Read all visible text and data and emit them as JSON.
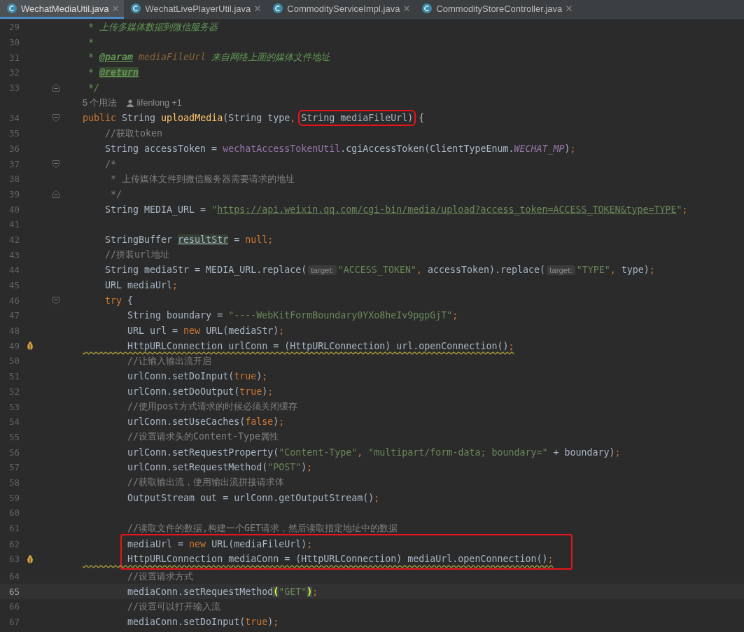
{
  "tabs": [
    {
      "label": "WechatMediaUtil.java",
      "selected": true
    },
    {
      "label": "WechatLivePlayerUtil.java",
      "selected": false
    },
    {
      "label": "CommodityServiceImpl.java",
      "selected": false
    },
    {
      "label": "CommodityStoreController.java",
      "selected": false
    }
  ],
  "editor": {
    "lines": [
      {
        "kind": "code",
        "number": "29",
        "tokens": [
          {
            "kind": "doc",
            "text": " * 上传多媒体数据到微信服务器"
          }
        ]
      },
      {
        "kind": "code",
        "number": "30",
        "tokens": [
          {
            "kind": "doc",
            "text": " *"
          }
        ]
      },
      {
        "kind": "code",
        "number": "31",
        "tokens": [
          {
            "kind": "doc",
            "text": " * "
          },
          {
            "kind": "doctag",
            "text": "@param"
          },
          {
            "kind": "docref",
            "text": " mediaFileUrl"
          },
          {
            "kind": "doc",
            "text": " 来自网络上面的媒体文件地址"
          }
        ]
      },
      {
        "kind": "code",
        "number": "32",
        "tokens": [
          {
            "kind": "doc",
            "text": " * "
          },
          {
            "kind": "doctag-hl",
            "text": "@return"
          }
        ]
      },
      {
        "kind": "code",
        "number": "33",
        "gutter": {
          "kind": "fold-end"
        },
        "tokens": [
          {
            "kind": "doc",
            "text": " */"
          }
        ]
      },
      {
        "kind": "inlay",
        "usages": "5 个用法",
        "author": "lifenlong +1"
      },
      {
        "kind": "code",
        "number": "34",
        "gutter": {
          "kind": "fold-start"
        },
        "tokens": [
          {
            "kind": "kw",
            "text": "public "
          },
          {
            "kind": "p",
            "text": "String "
          },
          {
            "kind": "fn",
            "text": "uploadMedia"
          },
          {
            "kind": "p",
            "text": "(String type"
          },
          {
            "kind": "kw",
            "text": ", "
          },
          {
            "kind": "p",
            "text": "String mediaFileUrl)",
            "boxed": true
          },
          {
            "kind": "p",
            "text": " {"
          }
        ]
      },
      {
        "kind": "code",
        "number": "35",
        "tokens": [
          {
            "kind": "cm",
            "text": "    //获取token"
          }
        ]
      },
      {
        "kind": "code",
        "number": "36",
        "tokens": [
          {
            "kind": "p",
            "text": "    String accessToken = "
          },
          {
            "kind": "field",
            "text": "wechatAccessTokenUtil"
          },
          {
            "kind": "p",
            "text": ".cgiAccessToken(ClientTypeEnum."
          },
          {
            "kind": "const",
            "text": "WECHAT_MP"
          },
          {
            "kind": "p",
            "text": ")"
          },
          {
            "kind": "kw",
            "text": ";"
          }
        ]
      },
      {
        "kind": "code",
        "number": "37",
        "gutter": {
          "kind": "fold-start"
        },
        "tokens": [
          {
            "kind": "cm",
            "text": "    /*"
          }
        ]
      },
      {
        "kind": "code",
        "number": "38",
        "tokens": [
          {
            "kind": "cm",
            "text": "     * 上传媒体文件到微信服务器需要请求的地址"
          }
        ]
      },
      {
        "kind": "code",
        "number": "39",
        "gutter": {
          "kind": "fold-end"
        },
        "tokens": [
          {
            "kind": "cm",
            "text": "     */"
          }
        ]
      },
      {
        "kind": "code",
        "number": "40",
        "tokens": [
          {
            "kind": "p",
            "text": "    String MEDIA_URL = "
          },
          {
            "kind": "str",
            "text": "\""
          },
          {
            "kind": "url",
            "text": "https://api.weixin.qq.com/cgi-bin/media/upload?access_token=ACCESS_TOKEN&type=TYPE"
          },
          {
            "kind": "str",
            "text": "\""
          },
          {
            "kind": "kw",
            "text": ";"
          }
        ]
      },
      {
        "kind": "code",
        "number": "41"
      },
      {
        "kind": "code",
        "number": "42",
        "tokens": [
          {
            "kind": "p",
            "text": "    StringBuffer "
          },
          {
            "kind": "unused",
            "text": "resultStr"
          },
          {
            "kind": "p",
            "text": " = "
          },
          {
            "kind": "kw",
            "text": "null;"
          }
        ]
      },
      {
        "kind": "code",
        "number": "43",
        "tokens": [
          {
            "kind": "cm",
            "text": "    //拼装url地址"
          }
        ]
      },
      {
        "kind": "code",
        "number": "44",
        "tokens": [
          {
            "kind": "p",
            "text": "    String mediaStr = MEDIA_URL.replace("
          },
          {
            "kind": "hint",
            "text": "target:"
          },
          {
            "kind": "str",
            "text": "\"ACCESS_TOKEN\""
          },
          {
            "kind": "kw",
            "text": ", "
          },
          {
            "kind": "p",
            "text": "accessToken).replace("
          },
          {
            "kind": "hint",
            "text": "target:"
          },
          {
            "kind": "str",
            "text": "\"TYPE\""
          },
          {
            "kind": "kw",
            "text": ", "
          },
          {
            "kind": "p",
            "text": "type)"
          },
          {
            "kind": "kw",
            "text": ";"
          }
        ]
      },
      {
        "kind": "code",
        "number": "45",
        "tokens": [
          {
            "kind": "p",
            "text": "    URL mediaUrl"
          },
          {
            "kind": "kw",
            "text": ";"
          }
        ]
      },
      {
        "kind": "code",
        "number": "46",
        "gutter": {
          "kind": "fold-start"
        },
        "tokens": [
          {
            "kind": "kw",
            "text": "    try "
          },
          {
            "kind": "p",
            "text": "{"
          }
        ]
      },
      {
        "kind": "code",
        "number": "47",
        "tokens": [
          {
            "kind": "p",
            "text": "        String boundary = "
          },
          {
            "kind": "str",
            "text": "\"----WebKitFormBoundary0YXo8heIv9pgpGjT\""
          },
          {
            "kind": "kw",
            "text": ";"
          }
        ]
      },
      {
        "kind": "code",
        "number": "48",
        "tokens": [
          {
            "kind": "p",
            "text": "        URL url = "
          },
          {
            "kind": "kw",
            "text": "new "
          },
          {
            "kind": "p",
            "text": "URL(mediaStr)"
          },
          {
            "kind": "kw",
            "text": ";"
          }
        ]
      },
      {
        "kind": "code",
        "number": "49",
        "gutter": {
          "kind": "bug"
        },
        "warning": true,
        "tokens": [
          {
            "kind": "p",
            "text": "        HttpURLConnection urlConn = (HttpURLConnection) url.openConnection()"
          },
          {
            "kind": "kw",
            "text": ";"
          }
        ]
      },
      {
        "kind": "code",
        "number": "50",
        "tokens": [
          {
            "kind": "cm",
            "text": "        //让输入输出流开启"
          }
        ]
      },
      {
        "kind": "code",
        "number": "51",
        "tokens": [
          {
            "kind": "p",
            "text": "        urlConn.setDoInput("
          },
          {
            "kind": "kw",
            "text": "true"
          },
          {
            "kind": "p",
            "text": ")"
          },
          {
            "kind": "kw",
            "text": ";"
          }
        ]
      },
      {
        "kind": "code",
        "number": "52",
        "tokens": [
          {
            "kind": "p",
            "text": "        urlConn.setDoOutput("
          },
          {
            "kind": "kw",
            "text": "true"
          },
          {
            "kind": "p",
            "text": ")"
          },
          {
            "kind": "kw",
            "text": ";"
          }
        ]
      },
      {
        "kind": "code",
        "number": "53",
        "tokens": [
          {
            "kind": "cm",
            "text": "        //使用post方式请求的时候必须关闭缓存"
          }
        ]
      },
      {
        "kind": "code",
        "number": "54",
        "tokens": [
          {
            "kind": "p",
            "text": "        urlConn.setUseCaches("
          },
          {
            "kind": "kw",
            "text": "false"
          },
          {
            "kind": "p",
            "text": ")"
          },
          {
            "kind": "kw",
            "text": ";"
          }
        ]
      },
      {
        "kind": "code",
        "number": "55",
        "tokens": [
          {
            "kind": "cm",
            "text": "        //设置请求头的Content-Type属性"
          }
        ]
      },
      {
        "kind": "code",
        "number": "56",
        "tokens": [
          {
            "kind": "p",
            "text": "        urlConn.setRequestProperty("
          },
          {
            "kind": "str",
            "text": "\"Content-Type\""
          },
          {
            "kind": "kw",
            "text": ", "
          },
          {
            "kind": "str",
            "text": "\"multipart/form-data; boundary=\""
          },
          {
            "kind": "p",
            "text": " + boundary)"
          },
          {
            "kind": "kw",
            "text": ";"
          }
        ]
      },
      {
        "kind": "code",
        "number": "57",
        "tokens": [
          {
            "kind": "p",
            "text": "        urlConn.setRequestMethod("
          },
          {
            "kind": "str",
            "text": "\"POST\""
          },
          {
            "kind": "p",
            "text": ")"
          },
          {
            "kind": "kw",
            "text": ";"
          }
        ]
      },
      {
        "kind": "code",
        "number": "58",
        "tokens": [
          {
            "kind": "cm",
            "text": "        //获取输出流，使用输出流拼接请求体"
          }
        ]
      },
      {
        "kind": "code",
        "number": "59",
        "tokens": [
          {
            "kind": "p",
            "text": "        OutputStream out = urlConn.getOutputStream()"
          },
          {
            "kind": "kw",
            "text": ";"
          }
        ]
      },
      {
        "kind": "code",
        "number": "60"
      },
      {
        "kind": "code",
        "number": "61",
        "tokens": [
          {
            "kind": "cm",
            "text": "        //读取文件的数据,构建一个GET请求，然后读取指定地址中的数据"
          }
        ]
      },
      {
        "kind": "code",
        "number": "62",
        "boxed": true,
        "tokens": [
          {
            "kind": "p",
            "text": "        mediaUrl = "
          },
          {
            "kind": "kw",
            "text": "new "
          },
          {
            "kind": "p",
            "text": "URL(mediaFileUrl)"
          },
          {
            "kind": "kw",
            "text": ";"
          }
        ]
      },
      {
        "kind": "code",
        "number": "63",
        "boxed": true,
        "gutter": {
          "kind": "bug"
        },
        "warning": true,
        "tokens": [
          {
            "kind": "p",
            "text": "        HttpURLConnection mediaConn = (HttpURLConnection) mediaUrl.openConnection()"
          },
          {
            "kind": "kw",
            "text": ";"
          }
        ]
      },
      {
        "kind": "code",
        "number": "64",
        "tokens": [
          {
            "kind": "cm",
            "text": "        //设置请求方式"
          }
        ]
      },
      {
        "kind": "code",
        "number": "65",
        "current": true,
        "tokens": [
          {
            "kind": "p",
            "text": "        mediaConn.setRequestMethod"
          },
          {
            "kind": "match",
            "text": "("
          },
          {
            "kind": "str",
            "text": "\"GET\""
          },
          {
            "kind": "match",
            "text": ")"
          },
          {
            "kind": "kw",
            "text": ";"
          }
        ]
      },
      {
        "kind": "code",
        "number": "66",
        "tokens": [
          {
            "kind": "cm",
            "text": "        //设置可以打开输入流"
          }
        ]
      },
      {
        "kind": "code",
        "number": "67",
        "tokens": [
          {
            "kind": "p",
            "text": "        mediaConn.setDoInput("
          },
          {
            "kind": "kw",
            "text": "true"
          },
          {
            "kind": "p",
            "text": ")"
          },
          {
            "kind": "kw",
            "text": ";"
          }
        ]
      }
    ]
  }
}
